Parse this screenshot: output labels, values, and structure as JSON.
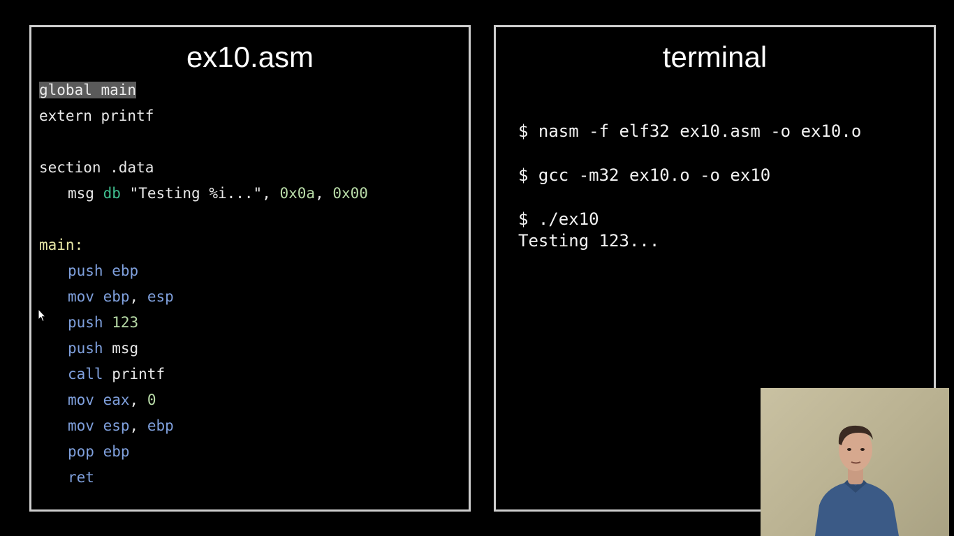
{
  "left_panel": {
    "title": "ex10.asm",
    "line_1": {
      "text": "global main"
    },
    "line_2": {
      "text": "extern printf"
    },
    "line_4": {
      "text": "section .data"
    },
    "line_5": {
      "name": "msg",
      "directive": "db",
      "string": "\"Testing %i...\"",
      "sep1": ", ",
      "byte1": "0x0a",
      "sep2": ", ",
      "byte2": "0x00"
    },
    "line_7": {
      "label": "main:"
    },
    "line_8": {
      "op": "push",
      "arg": "ebp"
    },
    "line_9": {
      "op": "mov",
      "arg1": "ebp",
      "sep": ", ",
      "arg2": "esp"
    },
    "line_10": {
      "op": "push",
      "arg": "123"
    },
    "line_11": {
      "op": "push",
      "arg": "msg"
    },
    "line_12": {
      "op": "call",
      "arg": "printf"
    },
    "line_13": {
      "op": "mov",
      "arg1": "eax",
      "sep": ", ",
      "arg2": "0"
    },
    "line_14": {
      "op": "mov",
      "arg1": "esp",
      "sep": ", ",
      "arg2": "ebp"
    },
    "line_15": {
      "op": "pop",
      "arg": "ebp"
    },
    "line_16": {
      "op": "ret"
    }
  },
  "right_panel": {
    "title": "terminal",
    "cmd_1": "$ nasm -f elf32 ex10.asm -o ex10.o",
    "cmd_2": "$ gcc -m32 ex10.o -o ex10",
    "cmd_3": "$ ./ex10",
    "output_1": "Testing 123..."
  },
  "colors": {
    "instruction": "#7fa0dd",
    "directive": "#3fbf8f",
    "number": "#b9dca8",
    "label": "#e7e7a6",
    "highlight_bg": "#5a5a5a",
    "border": "#cfcfcf",
    "background": "#000000"
  },
  "icons": {
    "cursor": "mouse-pointer-icon"
  }
}
